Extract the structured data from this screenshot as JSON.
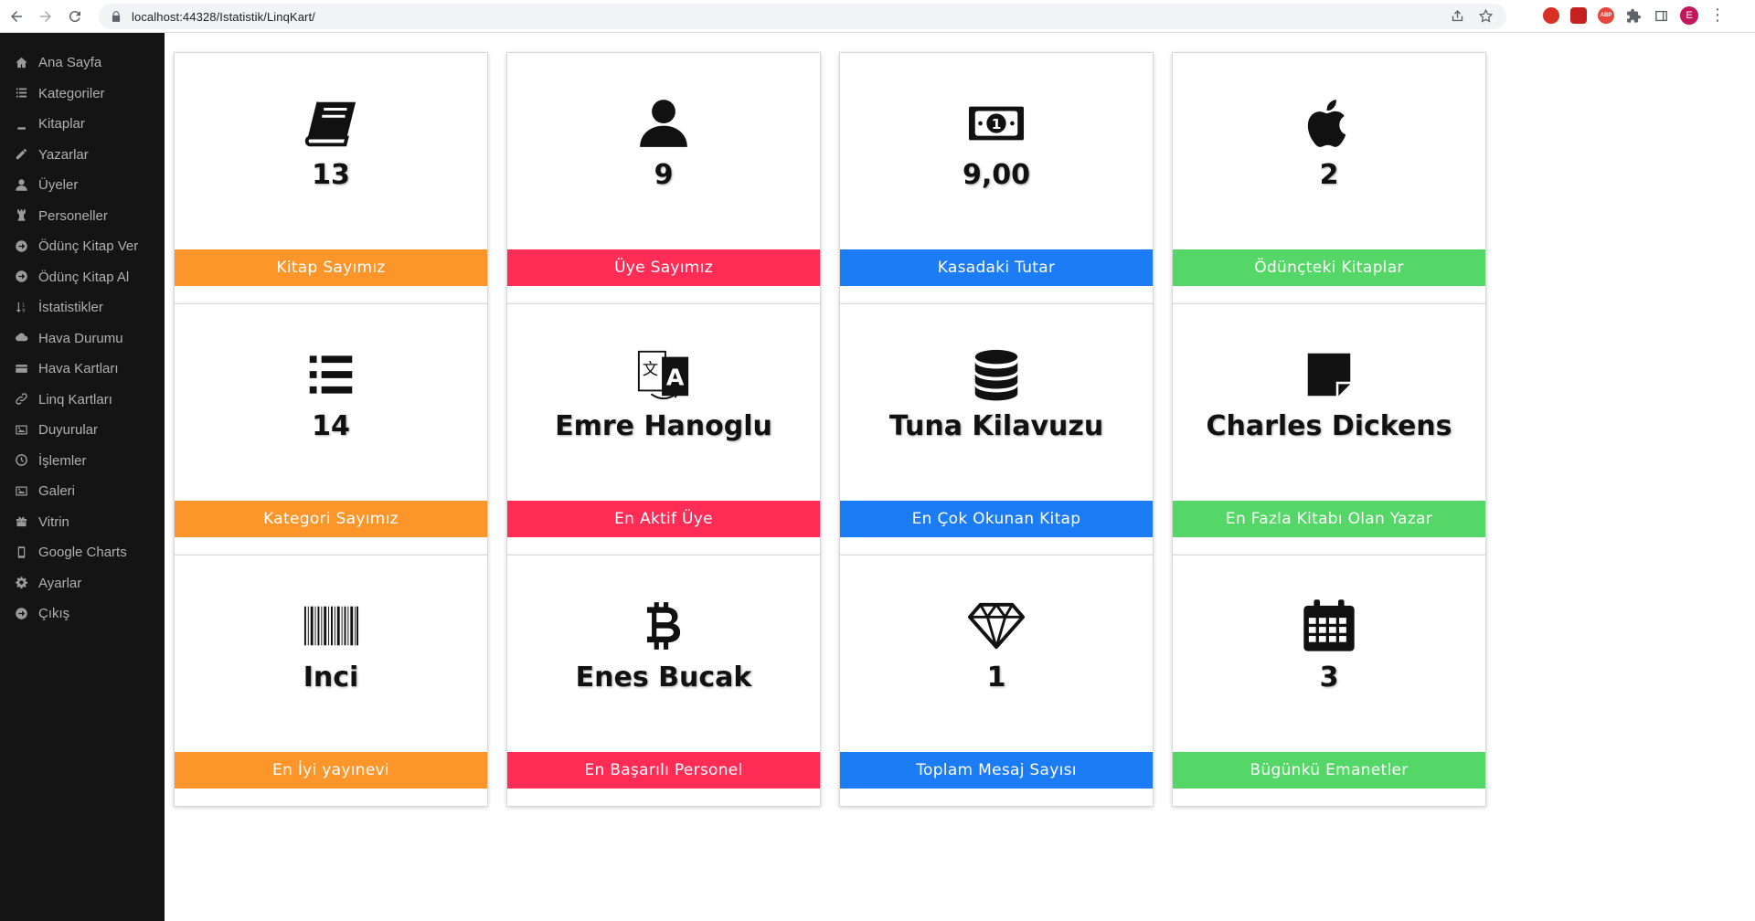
{
  "browser": {
    "url": "localhost:44328/Istatistik/LinqKart/",
    "avatar_letter": "E",
    "ext_abp": "ABP"
  },
  "sidebar": {
    "items": [
      {
        "label": "Ana Sayfa",
        "icon": "home-icon"
      },
      {
        "label": "Kategoriler",
        "icon": "list-icon"
      },
      {
        "label": "Kitaplar",
        "icon": "book-icon"
      },
      {
        "label": "Yazarlar",
        "icon": "pencil-icon"
      },
      {
        "label": "Üyeler",
        "icon": "user-icon"
      },
      {
        "label": "Personeller",
        "icon": "chess-rook-icon"
      },
      {
        "label": "Ödünç Kitap Ver",
        "icon": "circle-arrow-icon"
      },
      {
        "label": "Ödünç Kitap Al",
        "icon": "circle-arrow-icon"
      },
      {
        "label": "İstatistikler",
        "icon": "sort-numeric-icon"
      },
      {
        "label": "Hava Durumu",
        "icon": "cloud-icon"
      },
      {
        "label": "Hava Kartları",
        "icon": "credit-card-icon"
      },
      {
        "label": "Linq Kartları",
        "icon": "link-icon"
      },
      {
        "label": "Duyurular",
        "icon": "image-icon"
      },
      {
        "label": "İşlemler",
        "icon": "clock-icon"
      },
      {
        "label": "Galeri",
        "icon": "image-icon"
      },
      {
        "label": "Vitrin",
        "icon": "gift-icon"
      },
      {
        "label": "Google Charts",
        "icon": "mobile-icon"
      },
      {
        "label": "Ayarlar",
        "icon": "gear-icon"
      },
      {
        "label": "Çıkış",
        "icon": "circle-arrow-icon"
      }
    ]
  },
  "cards": [
    {
      "value": "13",
      "label": "Kitap Sayımız",
      "icon": "book-icon",
      "color": "#fd962a"
    },
    {
      "value": "9",
      "label": "Üye Sayımız",
      "icon": "user-icon",
      "color": "#ff2c56"
    },
    {
      "value": "9,00",
      "label": "Kasadaki Tutar",
      "icon": "money-bill-icon",
      "color": "#1b7cf6"
    },
    {
      "value": "2",
      "label": "Ödünçteki Kitaplar",
      "icon": "apple-icon",
      "color": "#55d767"
    },
    {
      "value": "14",
      "label": "Kategori Sayımız",
      "icon": "list-icon",
      "color": "#fd962a"
    },
    {
      "value": "Emre Hanoglu",
      "label": "En Aktif Üye",
      "icon": "language-icon",
      "color": "#ff2c56"
    },
    {
      "value": "Tuna Kilavuzu",
      "label": "En Çok Okunan Kitap",
      "icon": "database-icon",
      "color": "#1b7cf6"
    },
    {
      "value": "Charles Dickens",
      "label": "En Fazla Kitabı Olan Yazar",
      "icon": "sticky-note-icon",
      "color": "#55d767"
    },
    {
      "value": "Inci",
      "label": "En İyi yayınevi",
      "icon": "barcode-icon",
      "color": "#fd962a"
    },
    {
      "value": "Enes Bucak",
      "label": "En Başarılı Personel",
      "icon": "bitcoin-icon",
      "color": "#ff2c56"
    },
    {
      "value": "1",
      "label": "Toplam Mesaj Sayısı",
      "icon": "gem-icon",
      "color": "#1b7cf6"
    },
    {
      "value": "3",
      "label": "Bügünkü Emanetler",
      "icon": "calendar-icon",
      "color": "#55d767"
    }
  ]
}
